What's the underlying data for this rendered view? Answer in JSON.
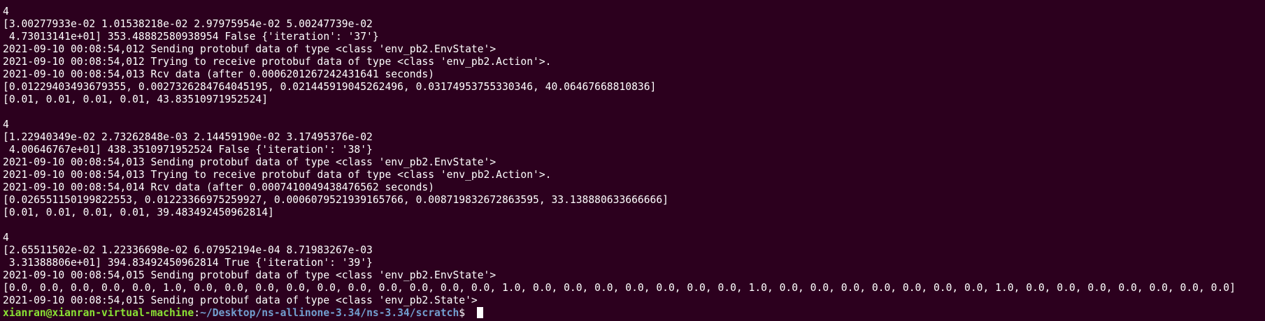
{
  "terminal": {
    "lines": [
      "4",
      "[3.00277933e-02 1.01538218e-02 2.97975954e-02 5.00247739e-02",
      " 4.73013141e+01] 353.48882580938954 False {'iteration': '37'}",
      "2021-09-10 00:08:54,012 Sending protobuf data of type <class 'env_pb2.EnvState'>",
      "2021-09-10 00:08:54,012 Trying to receive protobuf data of type <class 'env_pb2.Action'>.",
      "2021-09-10 00:08:54,013 Rcv data (after 0.0006201267242431641 seconds)",
      "[0.01229403493679355, 0.0027326284764045195, 0.021445919045262496, 0.03174953755330346, 40.06467668810836]",
      "[0.01, 0.01, 0.01, 0.01, 43.83510971952524]",
      "",
      "4",
      "[1.22940349e-02 2.73262848e-03 2.14459190e-02 3.17495376e-02",
      " 4.00646767e+01] 438.3510971952524 False {'iteration': '38'}",
      "2021-09-10 00:08:54,013 Sending protobuf data of type <class 'env_pb2.EnvState'>",
      "2021-09-10 00:08:54,013 Trying to receive protobuf data of type <class 'env_pb2.Action'>.",
      "2021-09-10 00:08:54,014 Rcv data (after 0.0007410049438476562 seconds)",
      "[0.02655115019982255​3, 0.01223366975259927, 0.0006079521939165766, 0.008719832672863595, 33.138880633666666]",
      "[0.01, 0.01, 0.01, 0.01, 39.483492450962814]",
      "",
      "4",
      "[2.65511502e-02 1.22336698e-02 6.07952194e-04 8.71983267e-03",
      " 3.31388806e+01] 394.83492450962814 True {'iteration': '39'}",
      "2021-09-10 00:08:54,015 Sending protobuf data of type <class 'env_pb2.EnvState'>",
      "[0.0, 0.0, 0.0, 0.0, 0.0, 1.0, 0.0, 0.0, 0.0, 0.0, 0.0, 0.0, 0.0, 0.0, 0.0, 0.0, 1.0, 0.0, 0.0, 0.0, 0.0, 0.0, 0.0, 0.0, 1.0, 0.0, 0.0, 0.0, 0.0, 0.0, 0.0, 0.0, 1.0, 0.0, 0.0, 0.0, 0.0, 0.0, 0.0, 0.0]",
      "2021-09-10 00:08:54,015 Sending protobuf data of type <class 'env_pb2.State'>"
    ],
    "prompt": {
      "user_host": "xianran@xianran-virtual-machine",
      "separator": ":",
      "path": "~/Desktop/ns-allinone-3.34/ns-3.34/scratch",
      "symbol": "$ "
    }
  },
  "colors": {
    "background": "#2c001e",
    "text": "#ffffff",
    "prompt_user": "#8ae234",
    "prompt_path": "#729fcf"
  }
}
